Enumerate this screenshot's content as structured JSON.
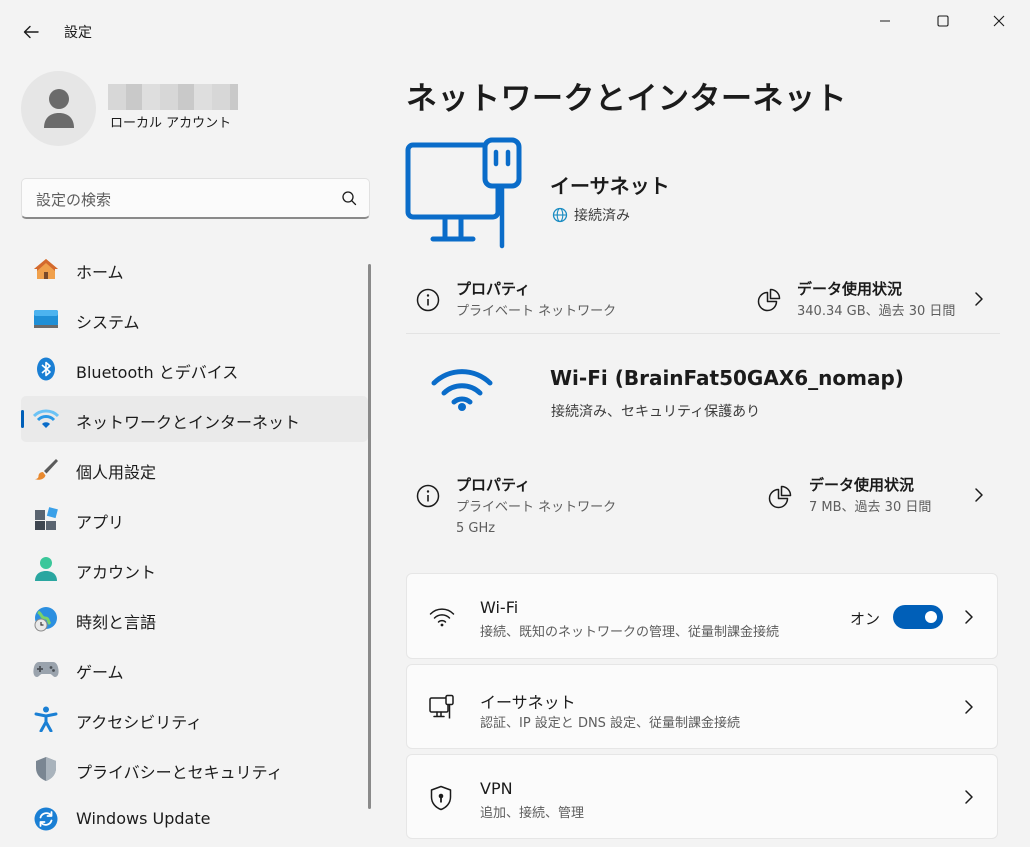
{
  "window": {
    "title": "設定"
  },
  "user": {
    "name": "",
    "account_type": "ローカル アカウント"
  },
  "search": {
    "placeholder": "設定の検索"
  },
  "sidebar": {
    "items": [
      {
        "label": "ホーム",
        "icon": "home-icon"
      },
      {
        "label": "システム",
        "icon": "monitor-icon"
      },
      {
        "label": "Bluetooth とデバイス",
        "icon": "bluetooth-icon"
      },
      {
        "label": "ネットワークとインターネット",
        "icon": "wifi-icon",
        "active": true
      },
      {
        "label": "個人用設定",
        "icon": "brush-icon"
      },
      {
        "label": "アプリ",
        "icon": "apps-icon"
      },
      {
        "label": "アカウント",
        "icon": "person-icon"
      },
      {
        "label": "時刻と言語",
        "icon": "globe-clock-icon"
      },
      {
        "label": "ゲーム",
        "icon": "gamepad-icon"
      },
      {
        "label": "アクセシビリティ",
        "icon": "accessibility-icon"
      },
      {
        "label": "プライバシーとセキュリティ",
        "icon": "shield-icon"
      },
      {
        "label": "Windows Update",
        "icon": "update-icon"
      }
    ]
  },
  "main": {
    "title": "ネットワークとインターネット",
    "ethernet": {
      "name": "イーサネット",
      "status": "接続済み",
      "properties_title": "プロパティ",
      "properties_sub": "プライベート ネットワーク",
      "usage_title": "データ使用状況",
      "usage_sub": "340.34 GB、過去 30 日間"
    },
    "wifi": {
      "name": "Wi-Fi (BrainFat50GAX6_nomap)",
      "status": "接続済み、セキュリティ保護あり",
      "properties_title": "プロパティ",
      "properties_sub": "プライベート ネットワーク",
      "properties_band": "5 GHz",
      "usage_title": "データ使用状況",
      "usage_sub": "7 MB、過去 30 日間"
    },
    "cards": [
      {
        "title": "Wi-Fi",
        "sub": "接続、既知のネットワークの管理、従量制課金接続",
        "toggle_label": "オン",
        "toggle_on": true
      },
      {
        "title": "イーサネット",
        "sub": "認証、IP 設定と DNS 設定、従量制課金接続"
      },
      {
        "title": "VPN",
        "sub": "追加、接続、管理"
      }
    ]
  },
  "colors": {
    "accent": "#005fb8",
    "icon_blue": "#0a6cc9"
  }
}
